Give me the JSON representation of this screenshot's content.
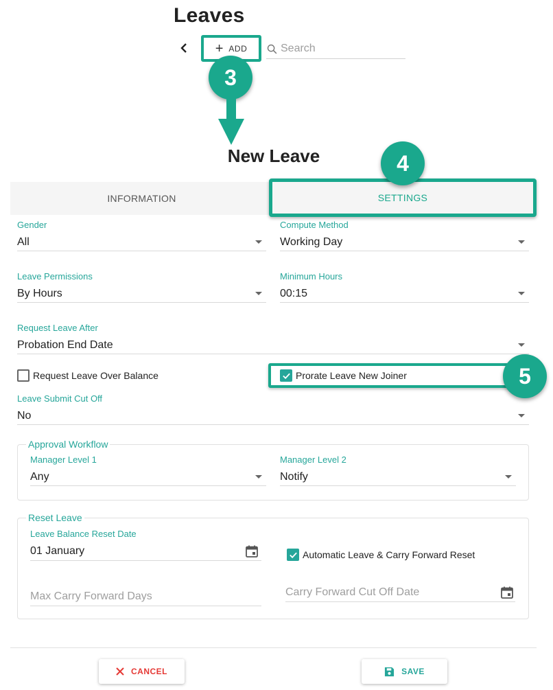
{
  "header": {
    "title": "Leaves",
    "add_label": "ADD",
    "search_placeholder": "Search"
  },
  "annotations": {
    "step3": "3",
    "step4": "4",
    "step5": "5",
    "accent_color": "#1aa88d"
  },
  "dialog": {
    "title": "New Leave",
    "tabs": [
      {
        "label": "INFORMATION",
        "active": false
      },
      {
        "label": "SETTINGS",
        "active": true
      }
    ]
  },
  "settings": {
    "gender": {
      "label": "Gender",
      "value": "All"
    },
    "compute_method": {
      "label": "Compute Method",
      "value": "Working Day"
    },
    "leave_permissions": {
      "label": "Leave Permissions",
      "value": "By Hours"
    },
    "minimum_hours": {
      "label": "Minimum Hours",
      "value": "00:15"
    },
    "request_leave_after": {
      "label": "Request Leave After",
      "value": "Probation End Date"
    },
    "request_over_balance": {
      "label": "Request Leave Over Balance",
      "checked": false
    },
    "prorate_new_joiner": {
      "label": "Prorate Leave New Joiner",
      "checked": true
    },
    "submit_cut_off": {
      "label": "Leave Submit Cut Off",
      "value": "No"
    },
    "approval_workflow": {
      "legend": "Approval Workflow",
      "manager_level_1": {
        "label": "Manager Level 1",
        "value": "Any"
      },
      "manager_level_2": {
        "label": "Manager Level 2",
        "value": "Notify"
      }
    },
    "reset_leave": {
      "legend": "Reset Leave",
      "reset_date": {
        "label": "Leave Balance Reset Date",
        "value": "01 January"
      },
      "auto_reset": {
        "label": "Automatic Leave & Carry Forward Reset",
        "checked": true
      },
      "max_carry_forward_placeholder": "Max Carry Forward Days",
      "carry_forward_cutoff_placeholder": "Carry Forward Cut Off Date"
    }
  },
  "footer": {
    "cancel_label": "CANCEL",
    "save_label": "SAVE"
  }
}
